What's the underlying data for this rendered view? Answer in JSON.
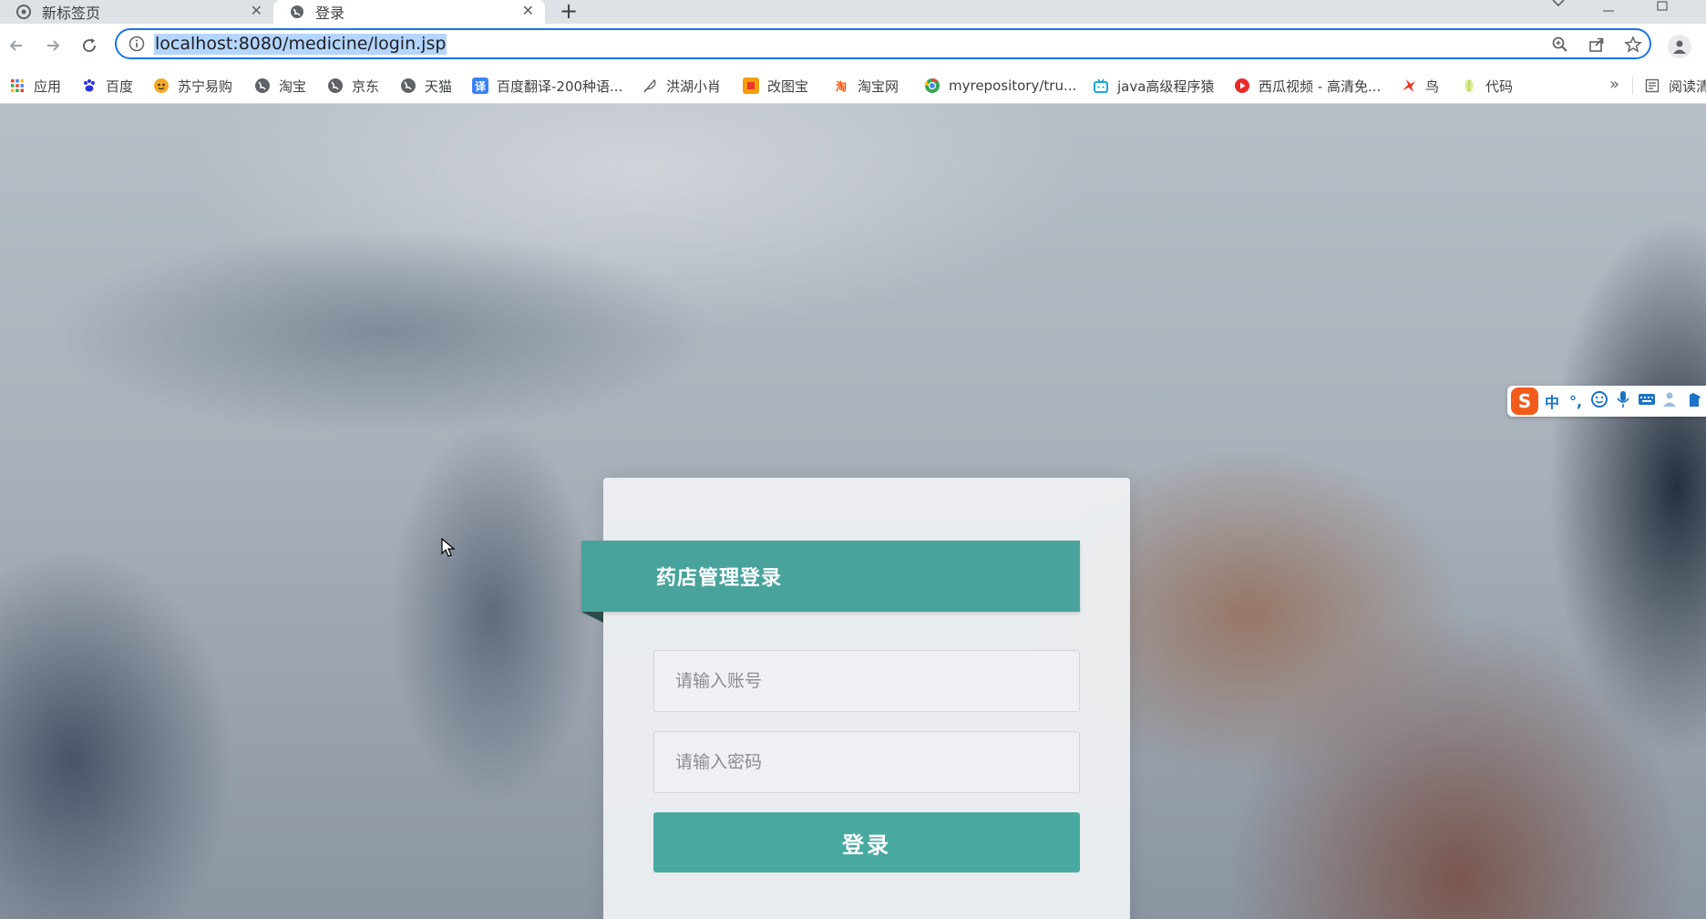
{
  "browser": {
    "tabs": [
      {
        "label": "新标签页",
        "active": false
      },
      {
        "label": "登录",
        "active": true
      }
    ],
    "new_tab_symbol": "+",
    "close_symbol": "✕",
    "url": "localhost:8080/medicine/login.jsp"
  },
  "bookmarks": [
    {
      "label": "应用",
      "icon": "apps-grid-icon",
      "color": "#ea4335"
    },
    {
      "label": "百度",
      "icon": "baidu-paw-icon",
      "color": "#2932e1"
    },
    {
      "label": "苏宁易购",
      "icon": "suning-icon",
      "color": "#f5a623"
    },
    {
      "label": "淘宝",
      "icon": "globe-icon",
      "color": "#5f6368"
    },
    {
      "label": "京东",
      "icon": "globe-icon",
      "color": "#5f6368"
    },
    {
      "label": "天猫",
      "icon": "globe-icon",
      "color": "#5f6368"
    },
    {
      "label": "百度翻译-200种语...",
      "icon": "translate-icon",
      "color": "#3b82f6"
    },
    {
      "label": "洪湖小肖",
      "icon": "feather-icon",
      "color": "#5f6368"
    },
    {
      "label": "改图宝",
      "icon": "gaitubao-icon",
      "color": "#f59e0b"
    },
    {
      "label": "淘宝网",
      "icon": "taobao-icon",
      "color": "#ff5000"
    },
    {
      "label": "myrepository/tru...",
      "icon": "chrome-icon",
      "color": "#34a853"
    },
    {
      "label": "java高级程序猿",
      "icon": "bilibili-icon",
      "color": "#00a1d6"
    },
    {
      "label": "西瓜视频 - 高清免...",
      "icon": "xigua-icon",
      "color": "#ea2a2a"
    },
    {
      "label": "鸟",
      "icon": "bird-icon",
      "color": "#e8362a"
    },
    {
      "label": "代码",
      "icon": "leaf-icon",
      "color": "#c5e17a"
    }
  ],
  "bookmarks_more": "»",
  "reading_list_label": "阅读清",
  "ime": {
    "logo": "S",
    "mode": "中",
    "punct": "°,"
  },
  "login": {
    "title": "药店管理登录",
    "username_placeholder": "请输入账号",
    "password_placeholder": "请输入密码",
    "submit_label": "登录",
    "accent_color": "#48a39c"
  }
}
